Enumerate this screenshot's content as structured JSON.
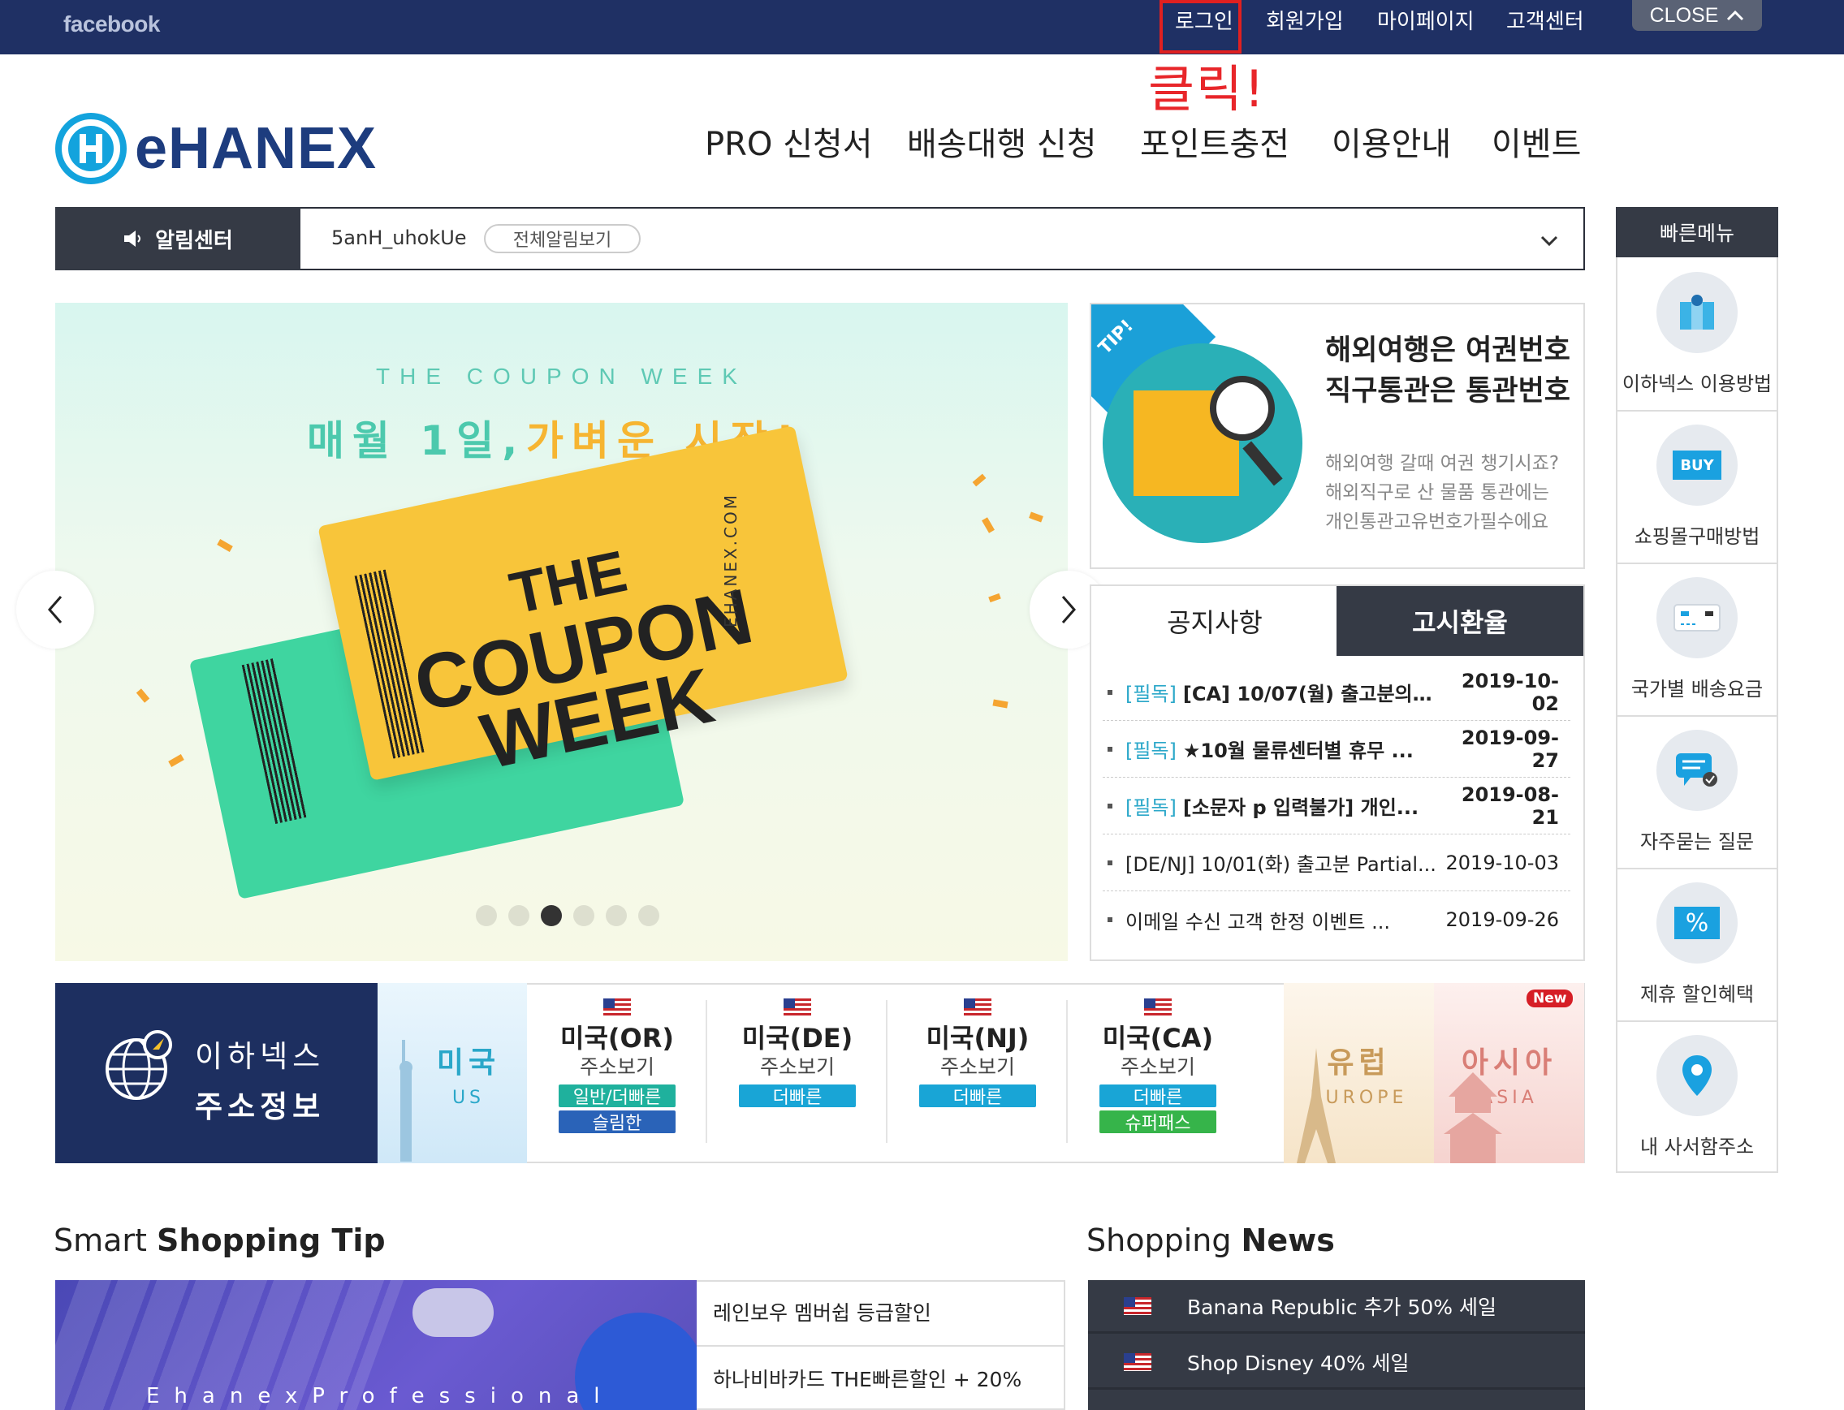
{
  "topbar": {
    "facebook": "facebook",
    "links": [
      "로그인",
      "회원가입",
      "마이페이지",
      "고객센터"
    ],
    "close": "CLOSE",
    "annotation": "클릭!"
  },
  "logo": {
    "text": "eHANEX"
  },
  "gnb": [
    "PRO 신청서",
    "배송대행 신청",
    "포인트충전",
    "이용안내",
    "이벤트"
  ],
  "notice_bar": {
    "label": "알림센터",
    "text": "5anH_uhokUe",
    "view_all": "전체알림보기"
  },
  "banner": {
    "kicker": "THE COUPON WEEK",
    "headline_a": "매월 1일,",
    "headline_b": "가벼운 시작!",
    "ticket_line1": "THE",
    "ticket_line2": "COUPON",
    "ticket_line3": "WEEK",
    "ticket_side": "EHANEX.COM",
    "slide_count": 6,
    "active_slide": 3
  },
  "tip": {
    "badge": "TIP!",
    "title1": "해외여행은 여권번호",
    "title2": "직구통관은 통관번호",
    "sub1": "해외여행 갈때 여권 챙기시죠?",
    "sub2": "해외직구로 산 물품 통관에는",
    "sub3": "개인통관고유번호가필수에요"
  },
  "tabs": {
    "notice": "공지사항",
    "rates": "고시환율",
    "items": [
      {
        "tag": "[필독]",
        "title": "[CA] 10/07(월) 출고분의 ...",
        "date": "2019-10-02",
        "bold": true
      },
      {
        "tag": "[필독]",
        "title": "★10월 물류센터별 휴무 ...",
        "date": "2019-09-27",
        "bold": true
      },
      {
        "tag": "[필독]",
        "title": "[소문자 p 입력불가] 개인...",
        "date": "2019-08-21",
        "bold": true
      },
      {
        "tag": "",
        "title": "[DE/NJ] 10/01(화) 출고분 Partial...",
        "date": "2019-10-03",
        "bold": false
      },
      {
        "tag": "",
        "title": "이메일 수신 고객 한정 이벤트 ...",
        "date": "2019-09-26",
        "bold": false
      }
    ]
  },
  "quick_menu": {
    "title": "빠른메뉴",
    "items": [
      "이하넥스 이용방법",
      "쇼핑몰구매방법",
      "국가별 배송요금",
      "자주묻는 질문",
      "제휴 할인혜택",
      "내 사서함주소"
    ],
    "buy_label": "BUY",
    "percent_label": "%"
  },
  "address": {
    "title1": "이하넥스",
    "title2": "주소정보",
    "us_name": "미국",
    "us_sub": "US",
    "columns": [
      {
        "name": "미국(OR)",
        "sub": "주소보기",
        "pills": [
          "일반/더빠른",
          "슬림한"
        ]
      },
      {
        "name": "미국(DE)",
        "sub": "주소보기",
        "pills": [
          "더빠른"
        ]
      },
      {
        "name": "미국(NJ)",
        "sub": "주소보기",
        "pills": [
          "더빠른"
        ]
      },
      {
        "name": "미국(CA)",
        "sub": "주소보기",
        "pills": [
          "더빠른",
          "슈퍼패스"
        ]
      }
    ],
    "europe_name": "유럽",
    "europe_sub": "EUROPE",
    "asia_name": "아시아",
    "asia_sub": "ASIA",
    "new_badge": "New"
  },
  "smart_tip": {
    "title_light": "Smart ",
    "title_bold": "Shopping Tip",
    "image_caption": "EhanexProfessional",
    "items": [
      "레인보우 멤버쉽 등급할인",
      "하나비바카드 THE빠른할인 + 20%"
    ]
  },
  "news": {
    "title_light": "Shopping ",
    "title_bold": "News",
    "items": [
      "Banana Republic 추가 50% 세일",
      "Shop Disney 40% 세일"
    ]
  },
  "colors": {
    "navy": "#1f3064",
    "dark": "#353a45",
    "accent": "#13a3dd",
    "red": "#e02020"
  }
}
